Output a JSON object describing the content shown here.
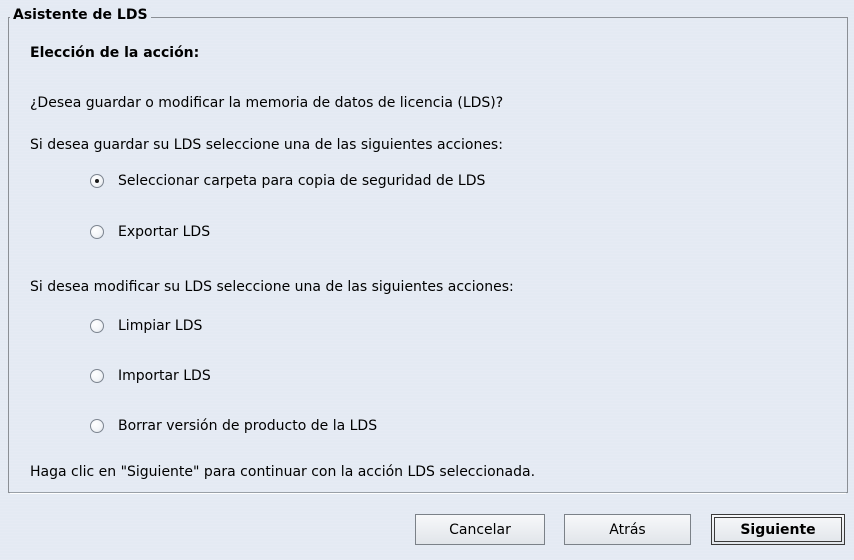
{
  "wizard": {
    "title": "Asistente de LDS",
    "section_heading": "Elección de la acción:",
    "question": "¿Desea guardar o modificar la memoria de datos de licencia (LDS)?",
    "save_intro": "Si desea guardar su LDS seleccione una de las siguientes acciones:",
    "save_options": [
      {
        "label": "Seleccionar carpeta para copia de seguridad de LDS",
        "selected": true
      },
      {
        "label": "Exportar LDS",
        "selected": false
      }
    ],
    "modify_intro": "Si desea modificar su LDS seleccione una de las siguientes acciones:",
    "modify_options": [
      {
        "label": "Limpiar LDS",
        "selected": false
      },
      {
        "label": "Importar LDS",
        "selected": false
      },
      {
        "label": "Borrar versión de producto de la LDS",
        "selected": false
      }
    ],
    "footer_hint": "Haga clic en \"Siguiente\" para continuar con la acción LDS seleccionada."
  },
  "buttons": {
    "cancel": "Cancelar",
    "back": "Atrás",
    "next": "Siguiente"
  }
}
